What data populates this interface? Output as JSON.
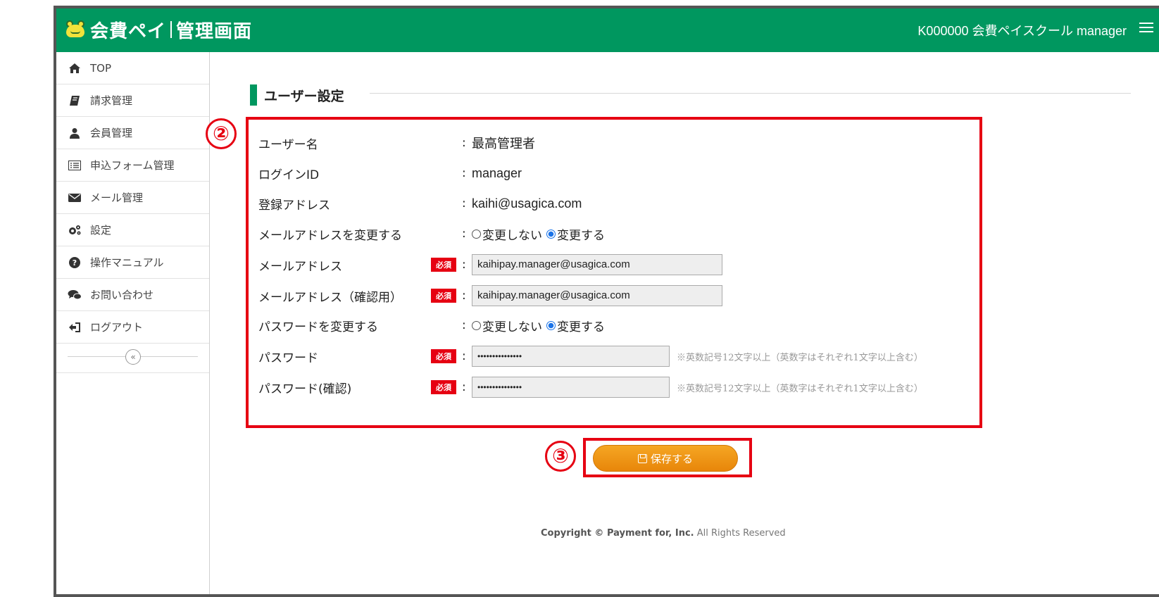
{
  "header": {
    "logo_main": "会費ペイ",
    "logo_sub": "管理画面",
    "user": "K000000 会費ペイスクール manager"
  },
  "sidebar": {
    "items": [
      {
        "label": "TOP",
        "icon": "home-icon"
      },
      {
        "label": "請求管理",
        "icon": "book-icon"
      },
      {
        "label": "会員管理",
        "icon": "user-icon"
      },
      {
        "label": "申込フォーム管理",
        "icon": "list-icon"
      },
      {
        "label": "メール管理",
        "icon": "envelope-icon"
      },
      {
        "label": "設定",
        "icon": "gears-icon"
      },
      {
        "label": "操作マニュアル",
        "icon": "question-icon"
      },
      {
        "label": "お問い合わせ",
        "icon": "chat-icon"
      },
      {
        "label": "ログアウト",
        "icon": "logout-icon"
      }
    ],
    "collapse": "«"
  },
  "page": {
    "title": "ユーザー設定",
    "badge_form": "②",
    "badge_save": "③"
  },
  "form": {
    "username": {
      "label": "ユーザー名",
      "value": "最高管理者"
    },
    "login_id": {
      "label": "ログインID",
      "value": "manager"
    },
    "registered_address": {
      "label": "登録アドレス",
      "value": "kaihi@usagica.com"
    },
    "change_mail": {
      "label": "メールアドレスを変更する",
      "opt_no": "変更しない",
      "opt_yes": "変更する",
      "selected": "変更する"
    },
    "mail": {
      "label": "メールアドレス",
      "value": "kaihipay.manager@usagica.com"
    },
    "mail_confirm": {
      "label": "メールアドレス（確認用）",
      "value": "kaihipay.manager@usagica.com"
    },
    "change_password": {
      "label": "パスワードを変更する",
      "opt_no": "変更しない",
      "opt_yes": "変更する",
      "selected": "変更する"
    },
    "password": {
      "label": "パスワード",
      "value": "•••••••••••••••",
      "hint": "※英数記号12文字以上（英数字はそれぞれ1文字以上含む）"
    },
    "password_confirm": {
      "label": "パスワード(確認)",
      "value": "•••••••••••••••",
      "hint": "※英数記号12文字以上（英数字はそれぞれ1文字以上含む）"
    },
    "required": "必須",
    "colon": ":"
  },
  "actions": {
    "save": "保存する"
  },
  "footer": {
    "copyright": "Copyright © ",
    "company": "Payment for, Inc.",
    "rights": " All Rights Reserved"
  }
}
